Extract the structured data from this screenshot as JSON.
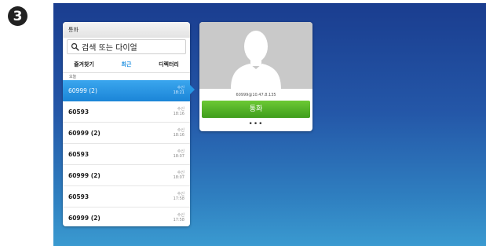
{
  "step_badge": "3",
  "panel": {
    "title": "통화",
    "search_placeholder": "검색 또는 다이얼",
    "tabs": [
      {
        "label": "즐겨찾기",
        "active": false
      },
      {
        "label": "최근",
        "active": true
      },
      {
        "label": "디렉터리",
        "active": false
      }
    ],
    "group_label": "오늘",
    "rows": [
      {
        "name": "60999 (2)",
        "type": "수신",
        "time": "18:21",
        "selected": true
      },
      {
        "name": "60593",
        "type": "수신",
        "time": "18:16",
        "selected": false
      },
      {
        "name": "60999 (2)",
        "type": "수신",
        "time": "18:16",
        "selected": false
      },
      {
        "name": "60593",
        "type": "수신",
        "time": "18:07",
        "selected": false
      },
      {
        "name": "60999 (2)",
        "type": "수신",
        "time": "18:07",
        "selected": false
      },
      {
        "name": "60593",
        "type": "수신",
        "time": "17:58",
        "selected": false
      },
      {
        "name": "60999 (2)",
        "type": "수신",
        "time": "17:58",
        "selected": false
      }
    ]
  },
  "contact_card": {
    "address": "60999@10.47.8.135",
    "call_label": "통화",
    "more_label": "•••"
  },
  "colors": {
    "accent": "#1e8fe0",
    "call_green": "#4fb024",
    "background_top": "#1a3d8f",
    "background_bottom": "#3a9ad0"
  }
}
